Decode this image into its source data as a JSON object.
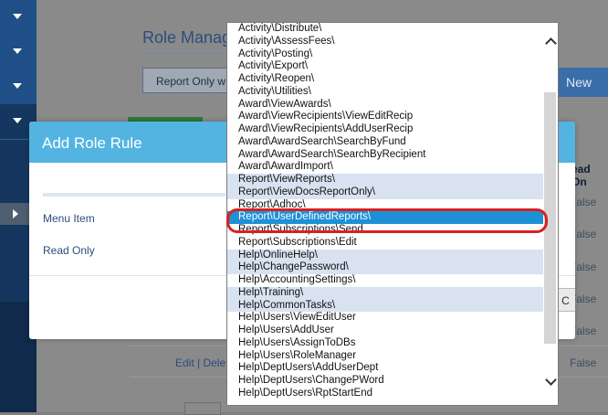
{
  "sidebar": {
    "expanders": [
      "chevron-down-icon",
      "chevron-down-icon",
      "chevron-down-icon",
      "chevron-down-icon"
    ],
    "active_arrow": "chevron-right-icon"
  },
  "page": {
    "title": "Role Manag",
    "report_button": "Report Only w",
    "new_button": "New",
    "col_header": "ead On",
    "false_values": [
      "False",
      "False",
      "False",
      "False",
      "False",
      "False",
      "False"
    ],
    "actions": "Edit | Dele"
  },
  "modal": {
    "title": "Add Role Rule",
    "fields": [
      "Menu Item",
      "Read Only"
    ],
    "footer_button": "C"
  },
  "dropdown": {
    "items": [
      {
        "label": "Activity\\Distribute\\",
        "state": "normal"
      },
      {
        "label": "Activity\\AssessFees\\",
        "state": "normal"
      },
      {
        "label": "Activity\\Posting\\",
        "state": "normal"
      },
      {
        "label": "Activity\\Export\\",
        "state": "normal"
      },
      {
        "label": "Activity\\Reopen\\",
        "state": "normal"
      },
      {
        "label": "Activity\\Utilities\\",
        "state": "normal"
      },
      {
        "label": "Award\\ViewAwards\\",
        "state": "normal"
      },
      {
        "label": "Award\\ViewRecipients\\ViewEditRecip",
        "state": "normal"
      },
      {
        "label": "Award\\ViewRecipients\\AddUserRecip",
        "state": "normal"
      },
      {
        "label": "Award\\AwardSearch\\SearchByFund",
        "state": "normal"
      },
      {
        "label": "Award\\AwardSearch\\SearchByRecipient",
        "state": "normal"
      },
      {
        "label": "Award\\AwardImport\\",
        "state": "normal"
      },
      {
        "label": "Report\\ViewReports\\",
        "state": "shaded"
      },
      {
        "label": "Report\\ViewDocsReportOnly\\",
        "state": "shaded"
      },
      {
        "label": "Report\\Adhoc\\",
        "state": "normal"
      },
      {
        "label": "Report\\UserDefinedReports\\",
        "state": "selected"
      },
      {
        "label": "Report\\Subscriptions\\Send",
        "state": "normal"
      },
      {
        "label": "Report\\Subscriptions\\Edit",
        "state": "normal"
      },
      {
        "label": "Help\\OnlineHelp\\",
        "state": "shaded"
      },
      {
        "label": "Help\\ChangePassword\\",
        "state": "shaded"
      },
      {
        "label": "Help\\AccountingSettings\\",
        "state": "normal"
      },
      {
        "label": "Help\\Training\\",
        "state": "shaded"
      },
      {
        "label": "Help\\CommonTasks\\",
        "state": "shaded"
      },
      {
        "label": "Help\\Users\\ViewEditUser",
        "state": "normal"
      },
      {
        "label": "Help\\Users\\AddUser",
        "state": "normal"
      },
      {
        "label": "Help\\Users\\AssignToDBs",
        "state": "normal"
      },
      {
        "label": "Help\\Users\\RoleManager",
        "state": "normal"
      },
      {
        "label": "Help\\DeptUsers\\AddUserDept",
        "state": "normal"
      },
      {
        "label": "Help\\DeptUsers\\ChangePWord",
        "state": "normal"
      },
      {
        "label": "Help\\DeptUsers\\RptStartEnd",
        "state": "normal"
      }
    ],
    "scroll_up_icon": "chevron-up-icon",
    "scroll_down_icon": "chevron-down-icon"
  },
  "colors": {
    "modal_header": "#53b4e1",
    "selection": "#1e90d6",
    "shaded_item": "#d8e2f0",
    "highlight_ring": "#d9201f"
  }
}
